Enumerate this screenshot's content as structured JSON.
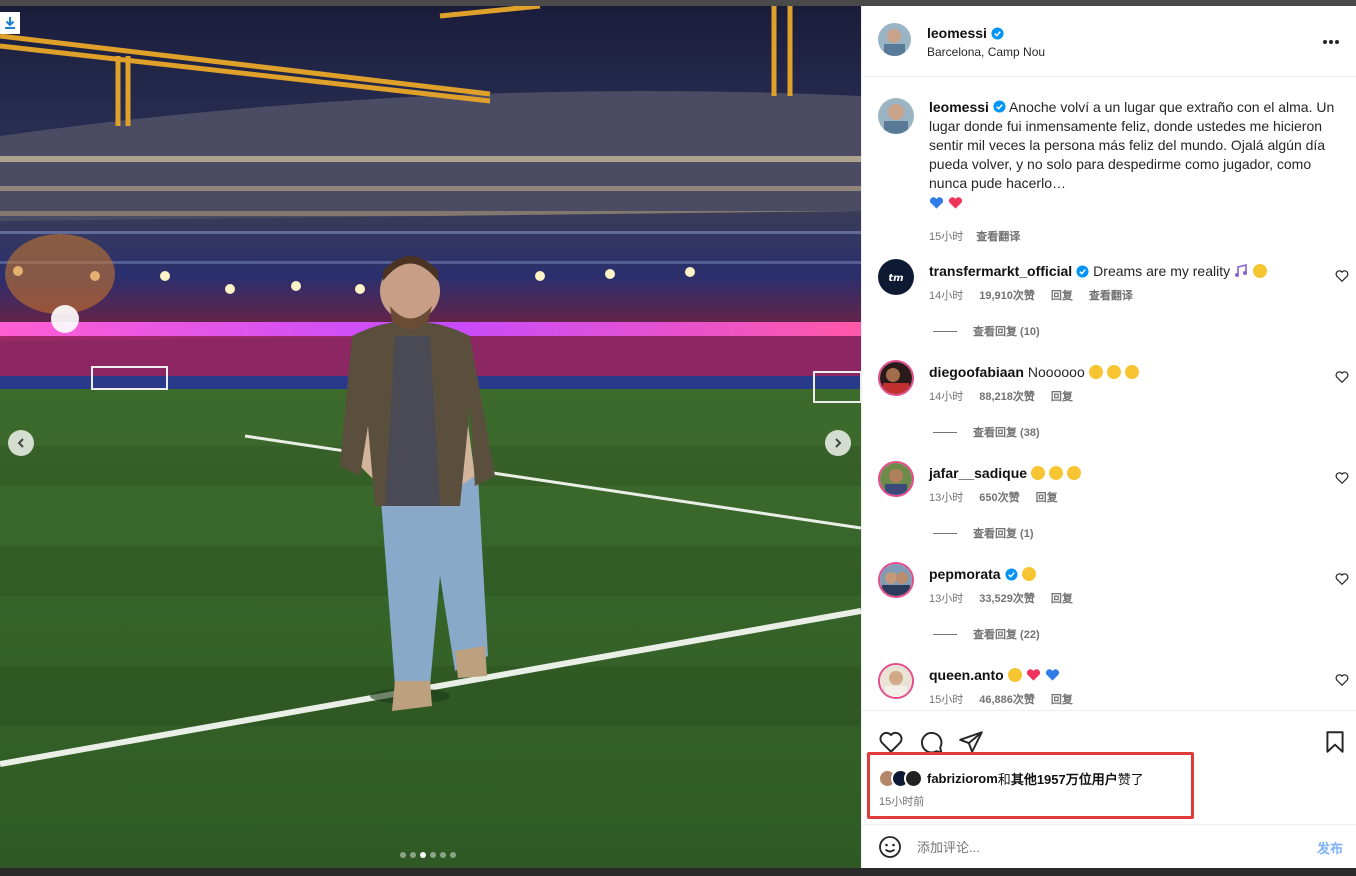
{
  "media": {
    "download_icon": "download-icon",
    "prev_icon": "chevron-left-icon",
    "next_icon": "chevron-right-icon",
    "slide_count": 6,
    "active_slide": 2
  },
  "header": {
    "username": "leomessi",
    "verified": true,
    "location": "Barcelona, Camp Nou",
    "more_icon": "more-horizontal-icon"
  },
  "caption": {
    "username": "leomessi",
    "text": "Anoche volví a un lugar que extraño con el alma. Un lugar donde fui inmensamente feliz, donde ustedes me hicieron sentir mil veces la persona más feliz del mundo. Ojalá algún día pueda volver, y no solo para despedirme como jugador, como nunca pude hacerlo…",
    "emojis": "💙❤️",
    "time": "15小时",
    "translate": "查看翻译"
  },
  "comments": [
    {
      "username": "transfermarkt_official",
      "verified": true,
      "text": "Dreams are my reality",
      "emojis": [
        "music-notes-emoji",
        "pleading-face-emoji"
      ],
      "time": "14小时",
      "likes": "19,910次赞",
      "reply": "回复",
      "translate": "查看翻译",
      "view_replies": "查看回复 (10)"
    },
    {
      "username": "diegoofabiaan",
      "verified": false,
      "text": "Noooooo",
      "emojis": [
        "crying-face-emoji",
        "crying-face-emoji",
        "crying-face-emoji"
      ],
      "time": "14小时",
      "likes": "88,218次赞",
      "reply": "回复",
      "view_replies": "查看回复 (38)"
    },
    {
      "username": "jafar__sadique",
      "verified": false,
      "text": "",
      "emojis": [
        "heart-eyes-emoji",
        "heart-eyes-emoji",
        "heart-eyes-emoji"
      ],
      "time": "13小时",
      "likes": "650次赞",
      "reply": "回复",
      "view_replies": "查看回复 (1)"
    },
    {
      "username": "pepmorata",
      "verified": true,
      "text": "",
      "emojis": [
        "flushed-face-emoji"
      ],
      "time": "13小时",
      "likes": "33,529次赞",
      "reply": "回复",
      "view_replies": "查看回复 (22)"
    },
    {
      "username": "queen.anto",
      "verified": false,
      "text": "",
      "emojis": [
        "pleading-face-emoji",
        "red-heart-emoji",
        "blue-heart-emoji"
      ],
      "time": "15小时",
      "likes": "46,886次赞",
      "reply": "回复"
    }
  ],
  "actions": {
    "like_icon": "heart-icon",
    "comment_icon": "comment-icon",
    "share_icon": "send-icon",
    "save_icon": "bookmark-icon"
  },
  "likes": {
    "liked_by": "fabriziorom",
    "and": "和",
    "others": "其他1957万位用户",
    "suffix": "赞了",
    "time_ago": "15小时前"
  },
  "comment_box": {
    "emoji_icon": "smile-icon",
    "placeholder": "添加评论...",
    "post_label": "发布"
  },
  "colors": {
    "verified": "#0095f6",
    "highlight": "#e13a3a",
    "post_button": "#7fb3f5",
    "secondary_text": "#737373"
  }
}
